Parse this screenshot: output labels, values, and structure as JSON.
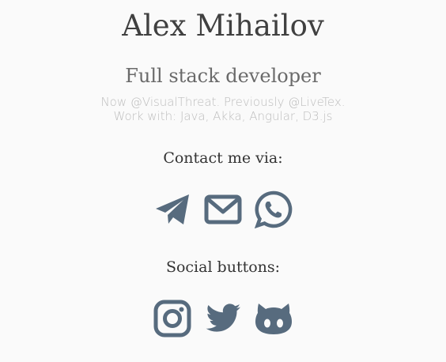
{
  "profile": {
    "name": "Alex Mihailov",
    "role": "Full stack developer",
    "bio_line1": "Now @VisualThreat. Previously @LiveTex.",
    "bio_line2": "Work with: Java, Akka, Angular, D3.js"
  },
  "contact": {
    "heading": "Contact me via:",
    "icons": [
      "telegram-icon",
      "email-icon",
      "whatsapp-icon"
    ]
  },
  "social": {
    "heading": "Social buttons:",
    "icons": [
      "instagram-icon",
      "twitter-icon",
      "github-icon"
    ]
  },
  "colors": {
    "icon": "#576b7e",
    "background": "#fafafa",
    "name": "#404040",
    "role": "#6a6a6a",
    "bio": "#bdbdbd"
  }
}
